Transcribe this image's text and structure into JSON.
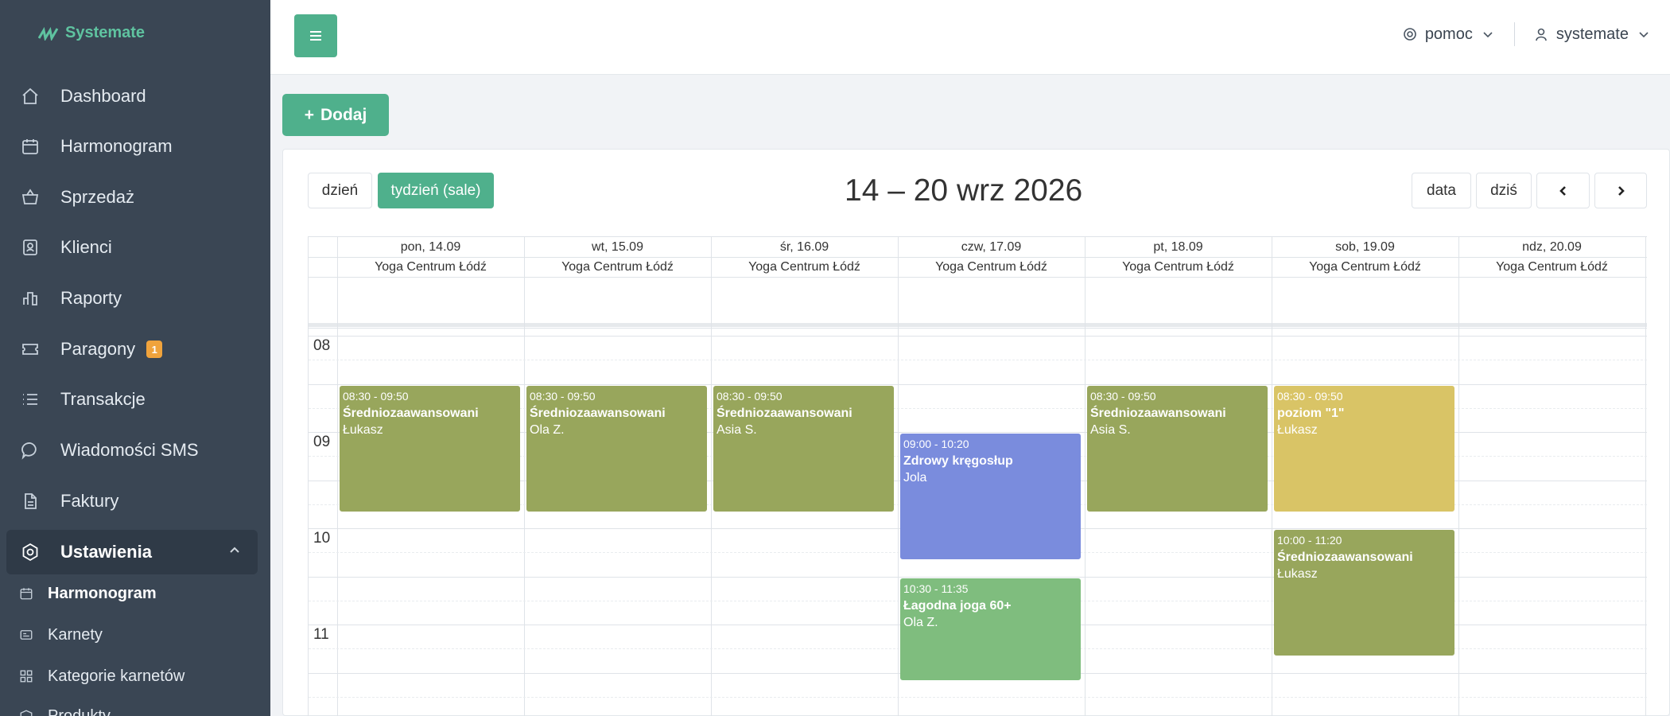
{
  "brand": {
    "name": "Systemate"
  },
  "sidebar": {
    "items": [
      {
        "label": "Dashboard",
        "icon": "home-icon"
      },
      {
        "label": "Harmonogram",
        "icon": "calendar-icon"
      },
      {
        "label": "Sprzedaż",
        "icon": "basket-icon"
      },
      {
        "label": "Klienci",
        "icon": "contacts-icon"
      },
      {
        "label": "Raporty",
        "icon": "chart-icon"
      },
      {
        "label": "Paragony",
        "icon": "ticket-icon",
        "badge": "1"
      },
      {
        "label": "Transakcje",
        "icon": "list-icon"
      },
      {
        "label": "Wiadomości SMS",
        "icon": "message-icon"
      },
      {
        "label": "Faktury",
        "icon": "document-icon"
      },
      {
        "label": "Ustawienia",
        "icon": "settings-icon"
      }
    ],
    "sub_items": [
      {
        "label": "Harmonogram",
        "icon": "calendar-icon"
      },
      {
        "label": "Karnety",
        "icon": "card-icon"
      },
      {
        "label": "Kategorie karnetów",
        "icon": "grid-icon"
      },
      {
        "label": "Produkty",
        "icon": "box-icon"
      }
    ]
  },
  "topbar": {
    "help": "pomoc",
    "user": "systemate"
  },
  "toolbar": {
    "add_label": "Dodaj",
    "day_label": "dzień",
    "week_label": "tydzień (sale)",
    "title": "14 – 20 wrz 2026",
    "date_label": "data",
    "today_label": "dziś"
  },
  "calendar": {
    "days": [
      "pon, 14.09",
      "wt, 15.09",
      "śr, 16.09",
      "czw, 17.09",
      "pt, 18.09",
      "sob, 19.09",
      "ndz, 20.09"
    ],
    "room": "Yoga Centrum Łódź",
    "hours": [
      "08",
      "09",
      "10",
      "11"
    ],
    "events": [
      {
        "day": 0,
        "start": "08:30",
        "end": "09:50",
        "time": "08:30 - 09:50",
        "name": "Średniozaawansowani",
        "person": "Łukasz",
        "color": "#98a65c"
      },
      {
        "day": 1,
        "start": "08:30",
        "end": "09:50",
        "time": "08:30 - 09:50",
        "name": "Średniozaawansowani",
        "person": "Ola Z.",
        "color": "#98a65c"
      },
      {
        "day": 2,
        "start": "08:30",
        "end": "09:50",
        "time": "08:30 - 09:50",
        "name": "Średniozaawansowani",
        "person": "Asia S.",
        "color": "#98a65c"
      },
      {
        "day": 3,
        "start": "09:00",
        "end": "10:20",
        "time": "09:00 - 10:20",
        "name": "Zdrowy kręgosłup",
        "person": "Jola",
        "color": "#7a8cdd"
      },
      {
        "day": 3,
        "start": "10:30",
        "end": "11:35",
        "time": "10:30 - 11:35",
        "name": "Łagodna joga 60+",
        "person": "Ola Z.",
        "color": "#7fbd7e"
      },
      {
        "day": 4,
        "start": "08:30",
        "end": "09:50",
        "time": "08:30 - 09:50",
        "name": "Średniozaawansowani",
        "person": "Asia S.",
        "color": "#98a65c"
      },
      {
        "day": 5,
        "start": "08:30",
        "end": "09:50",
        "time": "08:30 - 09:50",
        "name": "poziom \"1\"",
        "person": "Łukasz",
        "color": "#d9c466"
      },
      {
        "day": 5,
        "start": "10:00",
        "end": "11:20",
        "time": "10:00 - 11:20",
        "name": "Średniozaawansowani",
        "person": "Łukasz",
        "color": "#98a65c"
      }
    ]
  }
}
